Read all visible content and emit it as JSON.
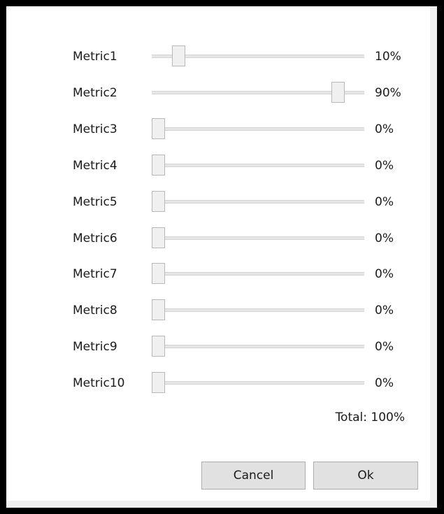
{
  "metrics": [
    {
      "label": "Metric1",
      "value_text": "10%",
      "level": 0.1
    },
    {
      "label": "Metric2",
      "value_text": "90%",
      "level": 0.9
    },
    {
      "label": "Metric3",
      "value_text": "0%",
      "level": 0.0
    },
    {
      "label": "Metric4",
      "value_text": "0%",
      "level": 0.0
    },
    {
      "label": "Metric5",
      "value_text": "0%",
      "level": 0.0
    },
    {
      "label": "Metric6",
      "value_text": "0%",
      "level": 0.0
    },
    {
      "label": "Metric7",
      "value_text": "0%",
      "level": 0.0
    },
    {
      "label": "Metric8",
      "value_text": "0%",
      "level": 0.0
    },
    {
      "label": "Metric9",
      "value_text": "0%",
      "level": 0.0
    },
    {
      "label": "Metric10",
      "value_text": "0%",
      "level": 0.0
    }
  ],
  "total": {
    "text": "Total: 100%"
  },
  "buttons": {
    "cancel_label": "Cancel",
    "ok_label": "Ok"
  }
}
